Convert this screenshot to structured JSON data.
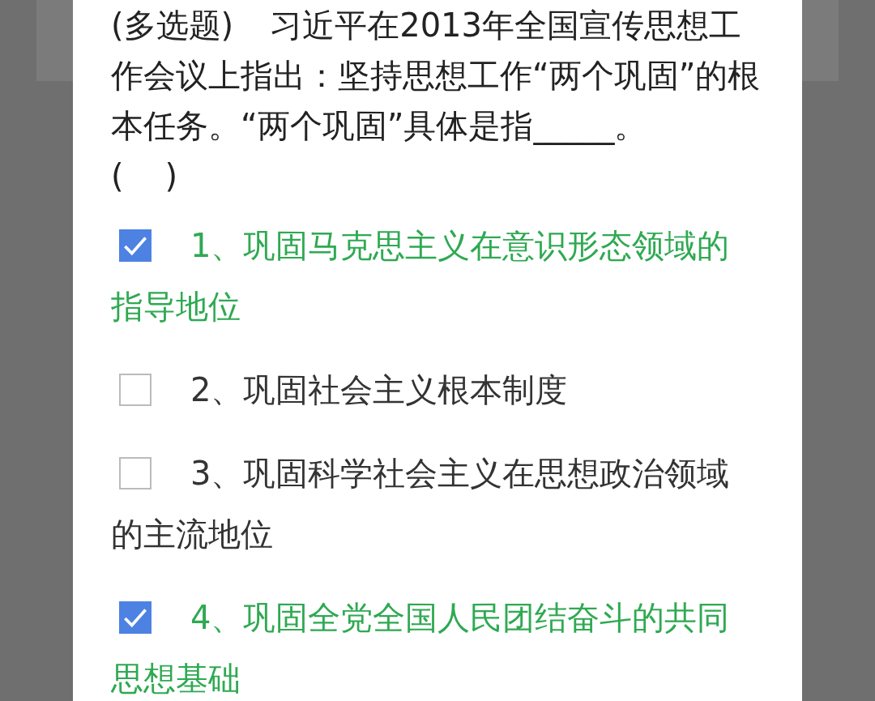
{
  "question": {
    "type_label": "(多选题)",
    "text": "习近平在2013年全国宣传思想工作会议上指出：坚持思想工作“两个巩固”的根本任务。“两个巩固”具体是指_____。",
    "answer_brackets": "(    )"
  },
  "options": [
    {
      "label": "1、巩固马克思主义在意识形态领域的指导地位",
      "checked": true
    },
    {
      "label": "2、巩固社会主义根本制度",
      "checked": false
    },
    {
      "label": "3、巩固科学社会主义在思想政治领域的主流地位",
      "checked": false
    },
    {
      "label": "4、巩固全党全国人民团结奋斗的共同思想基础",
      "checked": true
    }
  ]
}
